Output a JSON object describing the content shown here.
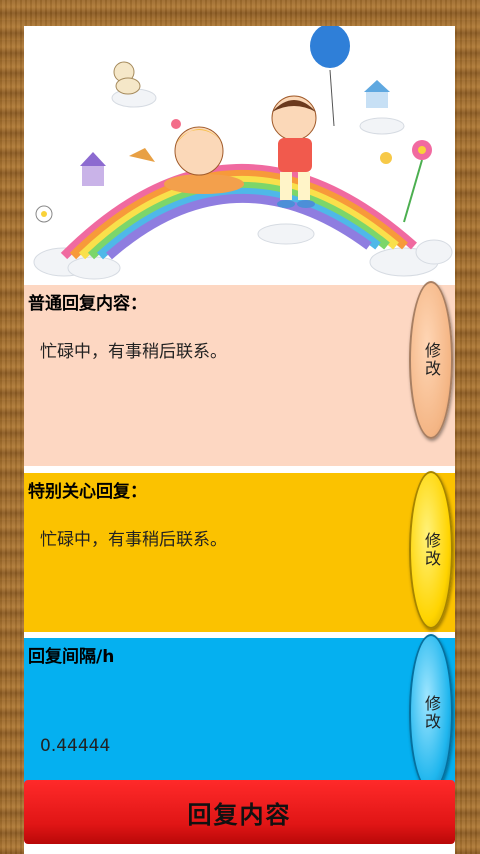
{
  "sections": [
    {
      "title": "普通回复内容：",
      "value": "忙碌中，有事稍后联系。",
      "button": "修改"
    },
    {
      "title": "特别关心回复：",
      "value": "忙碌中，有事稍后联系。",
      "button": "修改"
    },
    {
      "title": "回复间隔/h",
      "value": "0.44444",
      "button": "修改"
    }
  ],
  "bottom_button": "回复内容",
  "colors": {
    "section1": "#fdd7c2",
    "section2": "#fbc200",
    "section3": "#05b0f0",
    "bottom_button": "#e91b1b"
  }
}
